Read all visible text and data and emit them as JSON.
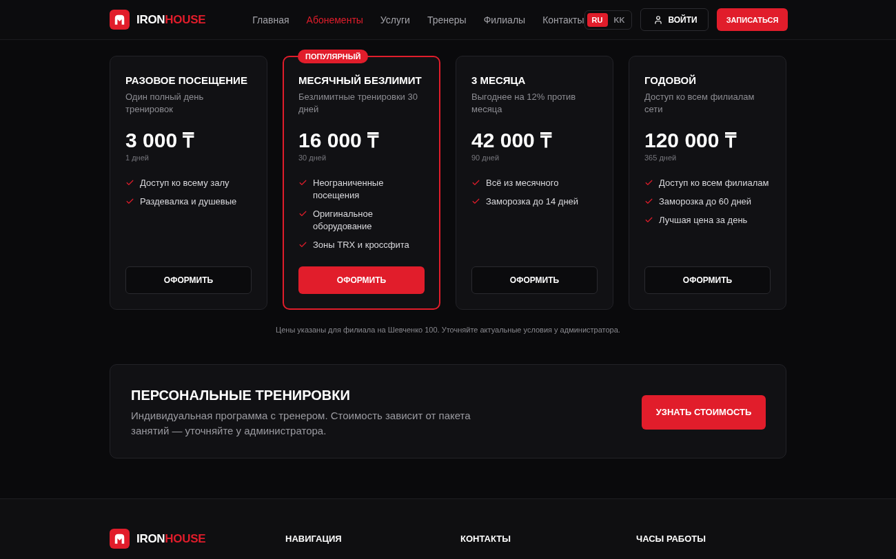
{
  "header": {
    "logo": {
      "primary": "IRON",
      "accent": "HOUSE"
    },
    "nav": [
      {
        "label": "Главная",
        "selected": false
      },
      {
        "label": "Абонементы",
        "selected": true
      },
      {
        "label": "Услуги",
        "selected": false
      },
      {
        "label": "Тренеры",
        "selected": false
      },
      {
        "label": "Филиалы",
        "selected": false
      },
      {
        "label": "Контакты",
        "selected": false
      }
    ],
    "languages": [
      {
        "label": "RU",
        "selected": true
      },
      {
        "label": "KK",
        "selected": false
      }
    ],
    "login_button": "ВОЙТИ",
    "signup_button": "ЗАПИСАТЬСЯ"
  },
  "plans": [
    {
      "title": "РАЗОВОЕ ПОСЕЩЕНИЕ",
      "description": "Один полный день тренировок",
      "price": "3 000 ₸",
      "duration": "1 дней",
      "features": [
        "Доступ ко всему залу",
        "Раздевалка и душевые"
      ],
      "button": "ОФОРМИТЬ",
      "highlighted": false
    },
    {
      "title": "МЕСЯЧНЫЙ БЕЗЛИМИТ",
      "badge": "ПОПУЛЯРНЫЙ",
      "description": "Безлимитные тренировки 30 дней",
      "price": "16 000 ₸",
      "duration": "30 дней",
      "features": [
        "Неограниченные посещения",
        "Оригинальное оборудование",
        "Зоны TRX и кроссфита"
      ],
      "button": "ОФОРМИТЬ",
      "highlighted": true
    },
    {
      "title": "3 МЕСЯЦА",
      "description": "Выгоднее на 12% против месяца",
      "price": "42 000 ₸",
      "duration": "90 дней",
      "features": [
        "Всё из месячного",
        "Заморозка до 14 дней"
      ],
      "button": "ОФОРМИТЬ",
      "highlighted": false
    },
    {
      "title": "ГОДОВОЙ",
      "description": "Доступ ко всем филиалам сети",
      "price": "120 000 ₸",
      "duration": "365 дней",
      "features": [
        "Доступ ко всем филиалам",
        "Заморозка до 60 дней",
        "Лучшая цена за день"
      ],
      "button": "ОФОРМИТЬ",
      "highlighted": false
    }
  ],
  "price_note": "Цены указаны для филиала на Шевченко 100. Уточняйте актуальные условия у администратора.",
  "personal_training": {
    "title": "ПЕРСОНАЛЬНЫЕ ТРЕНИРОВКИ",
    "description": "Индивидуальная программа с тренером. Стоимость зависит от пакета занятий — уточняйте у администратора.",
    "button": "УЗНАТЬ СТОИМОСТЬ"
  },
  "footer": {
    "logo": {
      "primary": "IRON",
      "accent": "HOUSE"
    },
    "columns": [
      {
        "heading": "НАВИГАЦИЯ"
      },
      {
        "heading": "КОНТАКТЫ"
      },
      {
        "heading": "ЧАСЫ РАБОТЫ"
      }
    ]
  }
}
